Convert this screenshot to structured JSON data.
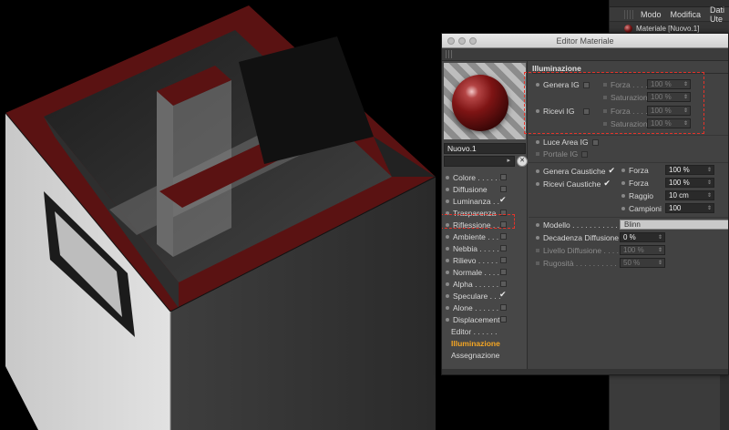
{
  "background_app": {
    "menu": [
      "Modo",
      "Modifica",
      "Dati Ute"
    ],
    "material_item": "Materiale [Nuovo.1]"
  },
  "editor": {
    "title": "Editor Materiale",
    "material_name": "Nuovo.1",
    "channels": [
      {
        "label": "Colore",
        "dots": " . . . . . .",
        "state": "box"
      },
      {
        "label": "Diffusione",
        "dots": "",
        "state": "box"
      },
      {
        "label": "Luminanza",
        "dots": " . .",
        "state": "check"
      },
      {
        "label": "Trasparenza",
        "dots": "",
        "state": "box"
      },
      {
        "label": "Riflessione",
        "dots": " . .",
        "state": "box"
      },
      {
        "label": "Ambiente",
        "dots": " . . .",
        "state": "box"
      },
      {
        "label": "Nebbia",
        "dots": " . . . . .",
        "state": "box"
      },
      {
        "label": "Rilievo",
        "dots": " . . . . .",
        "state": "box"
      },
      {
        "label": "Normale",
        "dots": " . . . .",
        "state": "box"
      },
      {
        "label": "Alpha",
        "dots": " . . . . . .",
        "state": "box"
      },
      {
        "label": "Speculare",
        "dots": " . . .",
        "state": "check"
      },
      {
        "label": "Alone",
        "dots": " . . . . . .",
        "state": "box"
      },
      {
        "label": "Displacement",
        "dots": "",
        "state": "box"
      },
      {
        "label": "Editor",
        "dots": " . . . . . .",
        "state": "plain"
      },
      {
        "label": "Illuminazione",
        "dots": "",
        "state": "active"
      },
      {
        "label": "Assegnazione",
        "dots": "",
        "state": "plain"
      }
    ],
    "section_title": "Illuminazione",
    "genera_ig": "Genera IG",
    "ricevi_ig": "Ricevi IG",
    "forza_dim": "Forza . . . . .",
    "saturazione": "Saturazione",
    "forza_val_dim": "100 %",
    "saturazione_val": "100 %",
    "luce_area_ig": "Luce Area IG",
    "portale_ig": "Portale IG",
    "genera_caustiche": "Genera Caustiche",
    "ricevi_caustiche": "Ricevi Caustiche",
    "forza": "Forza",
    "forza_val": "100 %",
    "raggio": "Raggio",
    "raggio_val": "10 cm",
    "campioni": "Campioni",
    "campioni_val": "100",
    "modello": "Modello . . . . . . . . . . . .",
    "modello_val": "Blinn",
    "decadenza": "Decadenza Diffusione",
    "decadenza_val": "0 %",
    "livello": "Livello Diffusione . . . .",
    "livello_val": "100 %",
    "rugosita": "Rugosità . . . . . . . . . .",
    "rugosita_val": "50 %"
  },
  "colors": {
    "highlight_outline": "#e5332a",
    "active_channel": "#f5a623",
    "frame_red": "#5a1212"
  }
}
